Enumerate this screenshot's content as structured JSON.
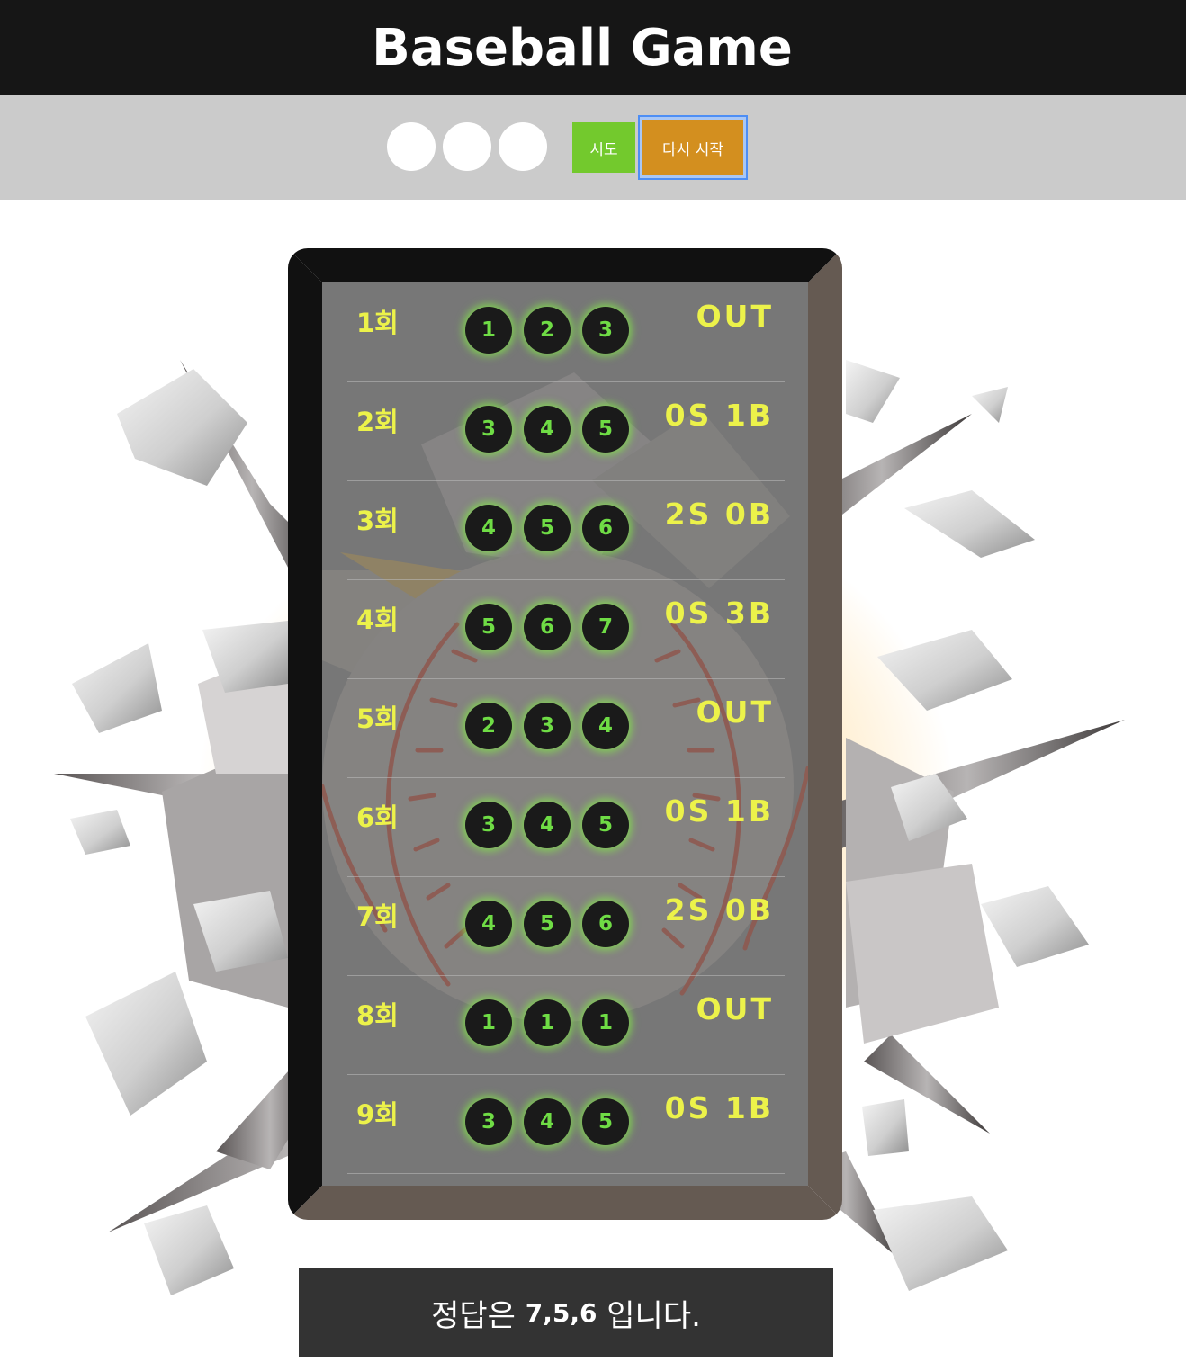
{
  "header": {
    "title": "Baseball Game"
  },
  "controls": {
    "inputs": [
      "",
      "",
      ""
    ],
    "try_label": "시도",
    "restart_label": "다시 시작"
  },
  "rows": [
    {
      "inning": "1회",
      "balls": [
        "1",
        "2",
        "3"
      ],
      "result": "OUT"
    },
    {
      "inning": "2회",
      "balls": [
        "3",
        "4",
        "5"
      ],
      "result": "0S 1B"
    },
    {
      "inning": "3회",
      "balls": [
        "4",
        "5",
        "6"
      ],
      "result": "2S 0B"
    },
    {
      "inning": "4회",
      "balls": [
        "5",
        "6",
        "7"
      ],
      "result": "0S 3B"
    },
    {
      "inning": "5회",
      "balls": [
        "2",
        "3",
        "4"
      ],
      "result": "OUT"
    },
    {
      "inning": "6회",
      "balls": [
        "3",
        "4",
        "5"
      ],
      "result": "0S 1B"
    },
    {
      "inning": "7회",
      "balls": [
        "4",
        "5",
        "6"
      ],
      "result": "2S 0B"
    },
    {
      "inning": "8회",
      "balls": [
        "1",
        "1",
        "1"
      ],
      "result": "OUT"
    },
    {
      "inning": "9회",
      "balls": [
        "3",
        "4",
        "5"
      ],
      "result": "0S 1B"
    }
  ],
  "answer": {
    "prefix": "정답은 ",
    "numbers": "7,5,6",
    "suffix": " 입니다."
  },
  "colors": {
    "header_bg": "#161616",
    "controls_bg": "#cbcbcb",
    "try_button": "#73c92d",
    "restart_button": "#d38f1f",
    "text_yellow": "#ecf24a",
    "ball_green": "#6fdc45",
    "answer_bg": "#333333"
  },
  "icons": {
    "background": "baseball-breaking-wall-illustration"
  }
}
